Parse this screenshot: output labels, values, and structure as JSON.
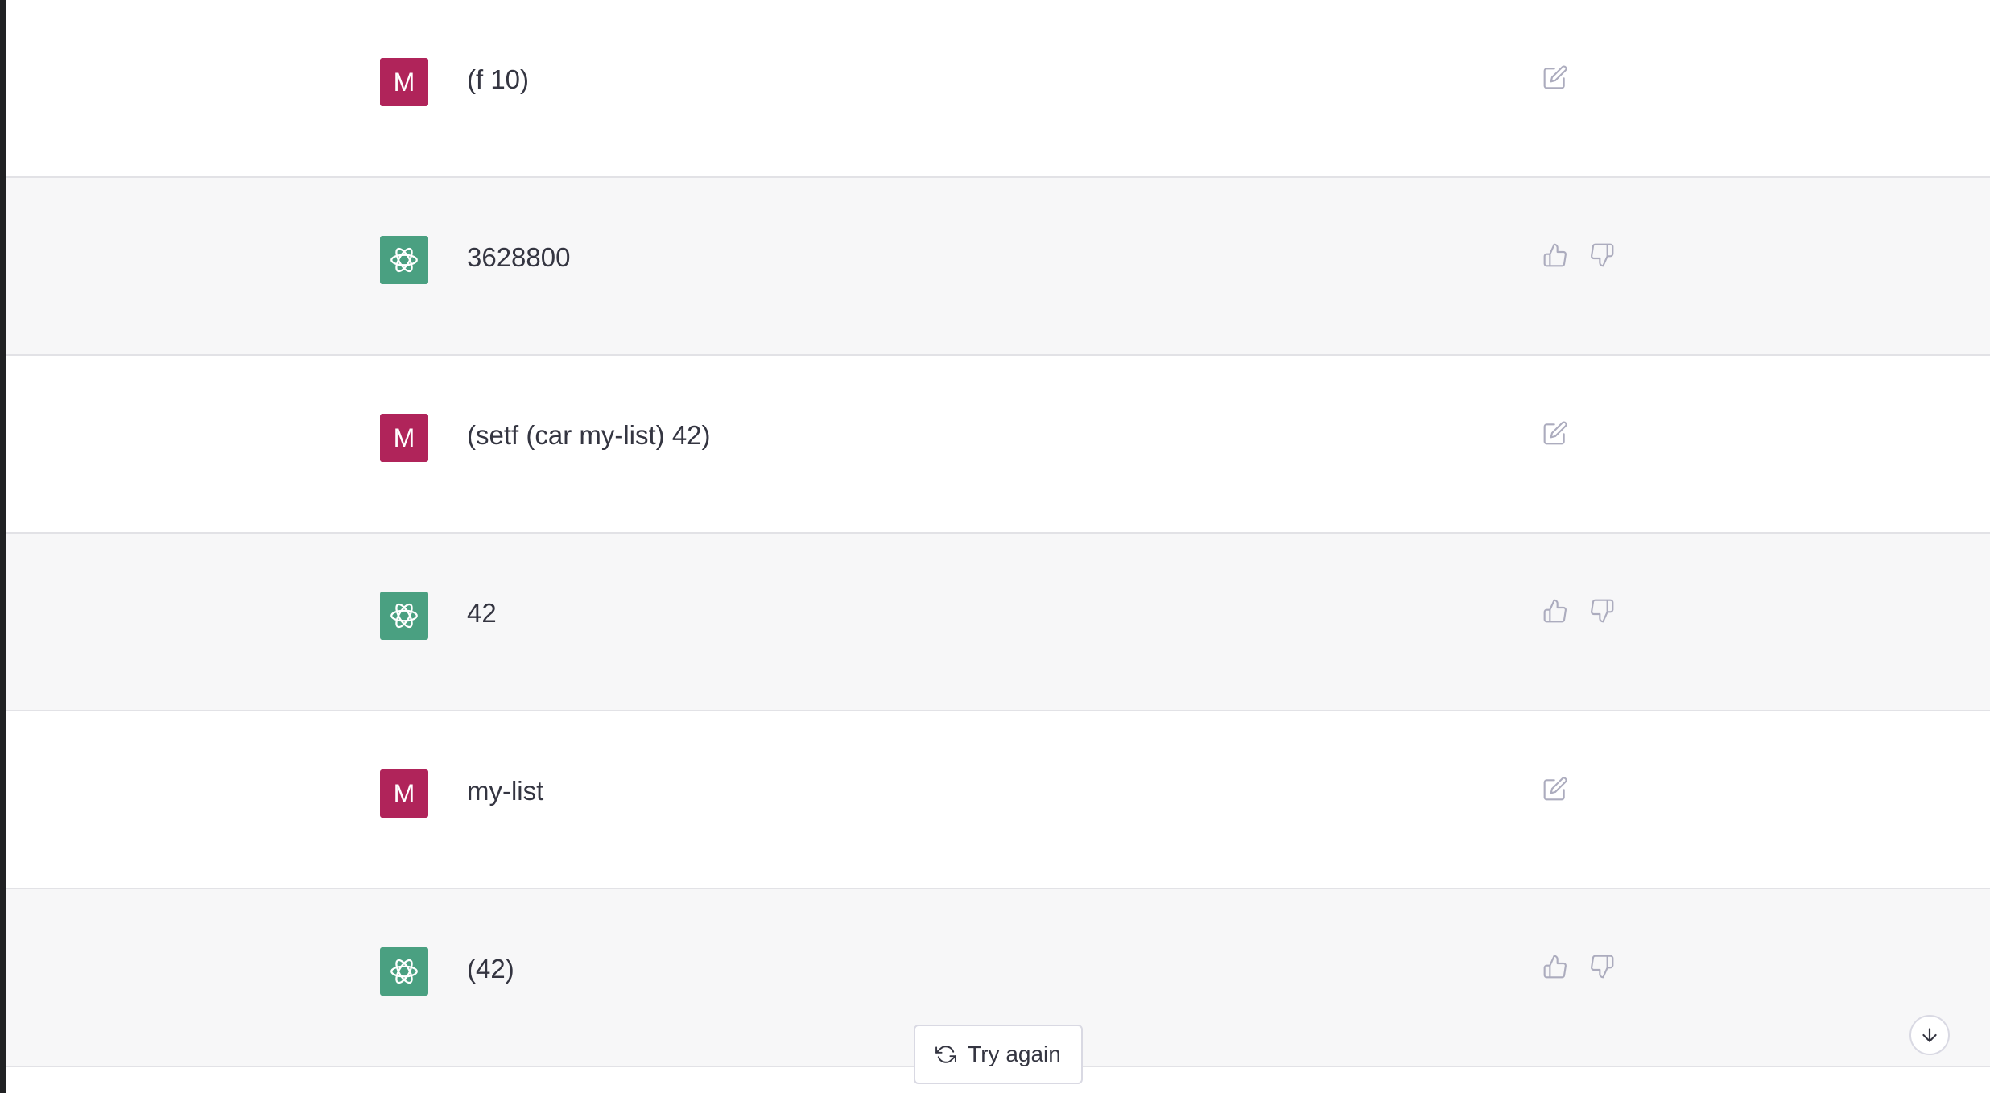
{
  "colors": {
    "user_avatar": "#b0245a",
    "assistant_avatar": "#4aa081",
    "assistant_row_bg": "#f7f7f8",
    "text": "#343541",
    "icon": "#acacbe"
  },
  "messages": [
    {
      "role": "user",
      "avatar_letter": "M",
      "text": "(f 10)"
    },
    {
      "role": "assistant",
      "avatar_icon": "openai-logo-icon",
      "text": "3628800"
    },
    {
      "role": "user",
      "avatar_letter": "M",
      "text": "(setf (car my-list) 42)"
    },
    {
      "role": "assistant",
      "avatar_icon": "openai-logo-icon",
      "text": "42"
    },
    {
      "role": "user",
      "avatar_letter": "M",
      "text": "my-list"
    },
    {
      "role": "assistant",
      "avatar_icon": "openai-logo-icon",
      "text": "(42)"
    }
  ],
  "controls": {
    "try_again_label": "Try again",
    "try_again_icon": "refresh-icon",
    "scroll_down_icon": "arrow-down-icon",
    "user_action_icon": "edit-icon",
    "assistant_action_icons": [
      "thumbs-up-icon",
      "thumbs-down-icon"
    ]
  }
}
